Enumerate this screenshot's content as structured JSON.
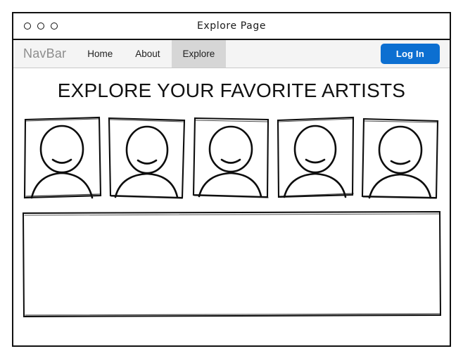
{
  "window": {
    "title": "Explore Page",
    "traffic_lights": [
      "close-dot",
      "minimize-dot",
      "maximize-dot"
    ]
  },
  "navbar": {
    "brand": "NavBar",
    "items": [
      {
        "label": "Home",
        "active": false
      },
      {
        "label": "About",
        "active": false
      },
      {
        "label": "Explore",
        "active": true
      }
    ],
    "login_label": "Log In",
    "accent_color": "#0c6fd1",
    "active_tab_color": "#d6d6d6",
    "background_color": "#f4f4f4"
  },
  "main": {
    "headline": "EXPLORE YOUR FAVORITE ARTISTS",
    "artists": [
      {
        "name": "artist-avatar-1"
      },
      {
        "name": "artist-avatar-2"
      },
      {
        "name": "artist-avatar-3"
      },
      {
        "name": "artist-avatar-4"
      },
      {
        "name": "artist-avatar-5"
      }
    ],
    "content_panel": {
      "label": "",
      "empty": true
    }
  }
}
